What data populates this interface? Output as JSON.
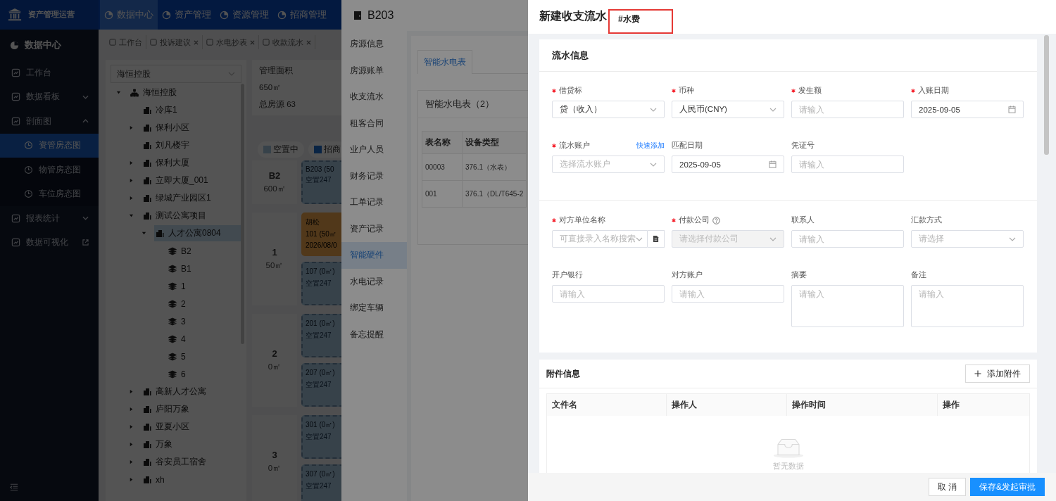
{
  "header": {
    "app_name": "资产管理运营",
    "nav": [
      {
        "label": "数据中心",
        "selected": true
      },
      {
        "label": "资产管理",
        "selected": false
      },
      {
        "label": "资源管理",
        "selected": false
      },
      {
        "label": "招商管理",
        "selected": false
      }
    ]
  },
  "sidebar": {
    "title": "数据中心",
    "items": [
      {
        "label": "工作台",
        "kind": "link",
        "selected": false
      },
      {
        "label": "数据看板",
        "kind": "group",
        "expanded": false,
        "selected": false
      },
      {
        "label": "剖面图",
        "kind": "group",
        "expanded": true,
        "selected": false,
        "children": [
          {
            "label": "资管房态图",
            "selected": true
          },
          {
            "label": "物管房态图",
            "selected": false
          },
          {
            "label": "车位房态图",
            "selected": false
          }
        ]
      },
      {
        "label": "报表统计",
        "kind": "group",
        "expanded": false,
        "selected": false
      },
      {
        "label": "数据可视化",
        "kind": "external",
        "selected": false
      }
    ]
  },
  "tabs": [
    {
      "label": "工作台",
      "closable": false
    },
    {
      "label": "投诉建议",
      "closable": true
    },
    {
      "label": "水电抄表",
      "closable": true
    },
    {
      "label": "收款流水",
      "closable": true
    }
  ],
  "tree": {
    "select": "海恒控股",
    "nodes": [
      {
        "label": "海恒控股",
        "kind": "org",
        "expanded": true,
        "selected": false,
        "children": [
          {
            "label": "冷库1",
            "kind": "building",
            "selected": false
          },
          {
            "label": "保利小区",
            "kind": "building",
            "expanded": false,
            "selected": false
          },
          {
            "label": "刘凡楼宇",
            "kind": "building",
            "selected": false
          },
          {
            "label": "保利大厦",
            "kind": "building",
            "expanded": false,
            "selected": false
          },
          {
            "label": "立即大厦_001",
            "kind": "building",
            "expanded": false,
            "selected": false
          },
          {
            "label": "绿城产业园区1",
            "kind": "building",
            "expanded": false,
            "selected": false
          },
          {
            "label": "测试公寓项目",
            "kind": "building",
            "expanded": true,
            "selected": false,
            "children": [
              {
                "label": "人才公寓0804",
                "kind": "building",
                "expanded": true,
                "selected": true,
                "children": [
                  {
                    "label": "B2",
                    "kind": "floor",
                    "selected": false
                  },
                  {
                    "label": "B1",
                    "kind": "floor",
                    "selected": false
                  },
                  {
                    "label": "1",
                    "kind": "floor",
                    "selected": false
                  },
                  {
                    "label": "2",
                    "kind": "floor",
                    "selected": false
                  },
                  {
                    "label": "3",
                    "kind": "floor",
                    "selected": false
                  },
                  {
                    "label": "4",
                    "kind": "floor",
                    "selected": false
                  },
                  {
                    "label": "5",
                    "kind": "floor",
                    "selected": false
                  },
                  {
                    "label": "6",
                    "kind": "floor",
                    "selected": false
                  }
                ]
              }
            ]
          },
          {
            "label": "高新人才公寓",
            "kind": "building",
            "expanded": false,
            "selected": false
          },
          {
            "label": "庐阳万象",
            "kind": "building",
            "expanded": false,
            "selected": false
          },
          {
            "label": "亚夏小区",
            "kind": "building",
            "expanded": false,
            "selected": false
          },
          {
            "label": "万象",
            "kind": "building",
            "expanded": false,
            "selected": false
          },
          {
            "label": "谷安员工宿舍",
            "kind": "building",
            "expanded": false,
            "selected": false
          },
          {
            "label": "xh",
            "kind": "building",
            "expanded": false,
            "selected": false
          }
        ]
      }
    ]
  },
  "stats": {
    "area_label": "管理面积",
    "area_value": "650㎡",
    "total": "总房源 63"
  },
  "legend": [
    {
      "label": "空置中",
      "kind": "vacant"
    },
    {
      "label": "招商",
      "kind": "leasing"
    }
  ],
  "floors": [
    {
      "name": "B2",
      "area": "600㎡",
      "rooms": [
        {
          "kind": "vacant",
          "title": "B203 (50",
          "sub": "空置247"
        }
      ]
    },
    {
      "name": "1",
      "area": "50㎡",
      "rooms": [
        {
          "kind": "rented",
          "tenant": "胡松",
          "title": "101 (50㎡",
          "sub": "2026/08/0"
        },
        {
          "kind": "vacant",
          "title": "107 (0㎡)",
          "sub": "空置247"
        }
      ]
    },
    {
      "name": "2",
      "area": "0㎡",
      "rooms": [
        {
          "kind": "vacant",
          "title": "201 (0㎡)",
          "sub": "空置247"
        },
        {
          "kind": "vacant",
          "title": "207 (0㎡)",
          "sub": "空置247"
        }
      ]
    },
    {
      "name": "3",
      "area": "0㎡",
      "rooms": [
        {
          "kind": "vacant",
          "title": "301 (0㎡)",
          "sub": "空置247"
        },
        {
          "kind": "vacant",
          "title": "307 (0㎡)",
          "sub": "空置247"
        }
      ]
    }
  ],
  "room_drawer": {
    "title": "B203",
    "menu": [
      {
        "label": "房源信息",
        "selected": false
      },
      {
        "label": "房源账单",
        "selected": false
      },
      {
        "label": "收支流水",
        "selected": false
      },
      {
        "label": "租客合同",
        "selected": false
      },
      {
        "label": "业户人员",
        "selected": false
      },
      {
        "label": "财务记录",
        "selected": false
      },
      {
        "label": "工单记录",
        "selected": false
      },
      {
        "label": "资产记录",
        "selected": false
      },
      {
        "label": "智能硬件",
        "selected": true
      },
      {
        "label": "水电记录",
        "selected": false
      },
      {
        "label": "绑定车辆",
        "selected": false
      },
      {
        "label": "备忘提醒",
        "selected": false
      }
    ],
    "tabs": [
      {
        "label": "智能水电表",
        "selected": true
      }
    ],
    "card_title": "智能水电表（2）",
    "table": {
      "columns": [
        "表名称",
        "设备类型"
      ],
      "rows": [
        [
          "00003",
          "376.1（水表）"
        ],
        [
          "001",
          "376.1（DL/T645-2"
        ]
      ]
    }
  },
  "form_drawer": {
    "title": "新建收支流水",
    "tag": "#水费",
    "info_card": {
      "title": "流水信息",
      "sections": [
        {
          "fields": [
            {
              "label": "借贷标",
              "required": true,
              "kind": "select",
              "value": "贷（收入）",
              "disabled": false,
              "help": false
            },
            {
              "label": "币种",
              "required": true,
              "kind": "select",
              "value": "人民币(CNY)",
              "disabled": false,
              "help": false
            },
            {
              "label": "发生额",
              "required": true,
              "kind": "input",
              "placeholder": "请输入",
              "disabled": false,
              "help": false
            },
            {
              "label": "入账日期",
              "required": true,
              "kind": "date",
              "value": "2025-09-05",
              "disabled": false,
              "help": false
            },
            {
              "label": "流水账户",
              "required": true,
              "kind": "select",
              "placeholder": "选择流水账户",
              "link": "快速添加",
              "disabled": false,
              "help": false
            },
            {
              "label": "匹配日期",
              "required": false,
              "kind": "date",
              "value": "2025-09-05",
              "disabled": false,
              "help": false
            },
            {
              "label": "凭证号",
              "required": false,
              "kind": "input",
              "placeholder": "请输入",
              "disabled": false,
              "help": false
            }
          ]
        },
        {
          "fields": [
            {
              "label": "对方单位名称",
              "required": true,
              "kind": "search-select",
              "placeholder": "可直接录入名称搜索",
              "disabled": false,
              "help": false
            },
            {
              "label": "付款公司",
              "required": true,
              "kind": "select",
              "placeholder": "请选择付款公司",
              "disabled": true,
              "help": true
            },
            {
              "label": "联系人",
              "required": false,
              "kind": "input",
              "placeholder": "请输入",
              "disabled": false,
              "help": false
            },
            {
              "label": "汇款方式",
              "required": false,
              "kind": "select",
              "placeholder": "请选择",
              "disabled": false,
              "help": false
            },
            {
              "label": "开户银行",
              "required": false,
              "kind": "input",
              "placeholder": "请输入",
              "disabled": false,
              "help": false
            },
            {
              "label": "对方账户",
              "required": false,
              "kind": "input",
              "placeholder": "请输入",
              "disabled": false,
              "help": false
            },
            {
              "label": "摘要",
              "required": false,
              "kind": "textarea",
              "placeholder": "请输入",
              "disabled": false,
              "help": false
            },
            {
              "label": "备注",
              "required": false,
              "kind": "textarea",
              "placeholder": "请输入",
              "disabled": false,
              "help": false
            }
          ]
        }
      ]
    },
    "attachments": {
      "title": "附件信息",
      "add_button": "添加附件",
      "columns": [
        "文件名",
        "操作人",
        "操作时间",
        "操作"
      ],
      "empty_text": "暂无数据"
    },
    "footer": {
      "cancel": "取 消",
      "submit": "保存&发起审批"
    }
  }
}
